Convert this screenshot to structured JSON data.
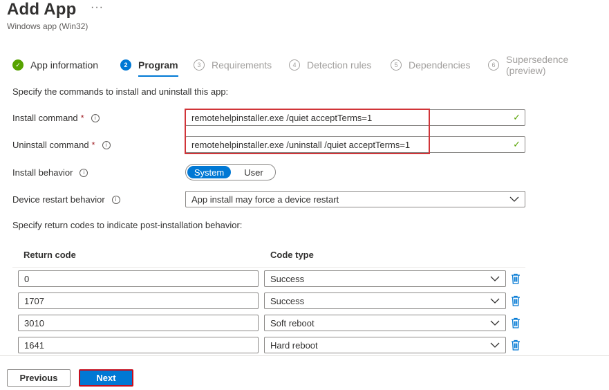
{
  "header": {
    "title": "Add App",
    "more": "···",
    "subtitle": "Windows app (Win32)"
  },
  "steps": [
    {
      "number": "✓",
      "label": "App information",
      "state": "done"
    },
    {
      "number": "2",
      "label": "Program",
      "state": "active"
    },
    {
      "number": "3",
      "label": "Requirements",
      "state": "pending"
    },
    {
      "number": "4",
      "label": "Detection rules",
      "state": "pending"
    },
    {
      "number": "5",
      "label": "Dependencies",
      "state": "pending"
    },
    {
      "number": "6",
      "label": "Supersedence (preview)",
      "state": "pending"
    }
  ],
  "form": {
    "intro": "Specify the commands to install and uninstall this app:",
    "install_command": {
      "label": "Install command",
      "required": "*",
      "value": "remotehelpinstaller.exe /quiet acceptTerms=1"
    },
    "uninstall_command": {
      "label": "Uninstall command",
      "required": "*",
      "value": "remotehelpinstaller.exe /uninstall /quiet acceptTerms=1"
    },
    "install_behavior": {
      "label": "Install behavior",
      "options": [
        "System",
        "User"
      ],
      "selected": "System"
    },
    "device_restart": {
      "label": "Device restart behavior",
      "value": "App install may force a device restart"
    },
    "info_glyph": "i",
    "valid_glyph": "✓"
  },
  "return_codes": {
    "intro": "Specify return codes to indicate post-installation behavior:",
    "headers": {
      "code": "Return code",
      "type": "Code type"
    },
    "rows": [
      {
        "code": "0",
        "type": "Success"
      },
      {
        "code": "1707",
        "type": "Success"
      },
      {
        "code": "3010",
        "type": "Soft reboot"
      },
      {
        "code": "1641",
        "type": "Hard reboot"
      }
    ]
  },
  "footer": {
    "previous": "Previous",
    "next": "Next"
  },
  "colors": {
    "accent": "#0078d4",
    "success": "#57a300",
    "highlight": "#d13438"
  }
}
